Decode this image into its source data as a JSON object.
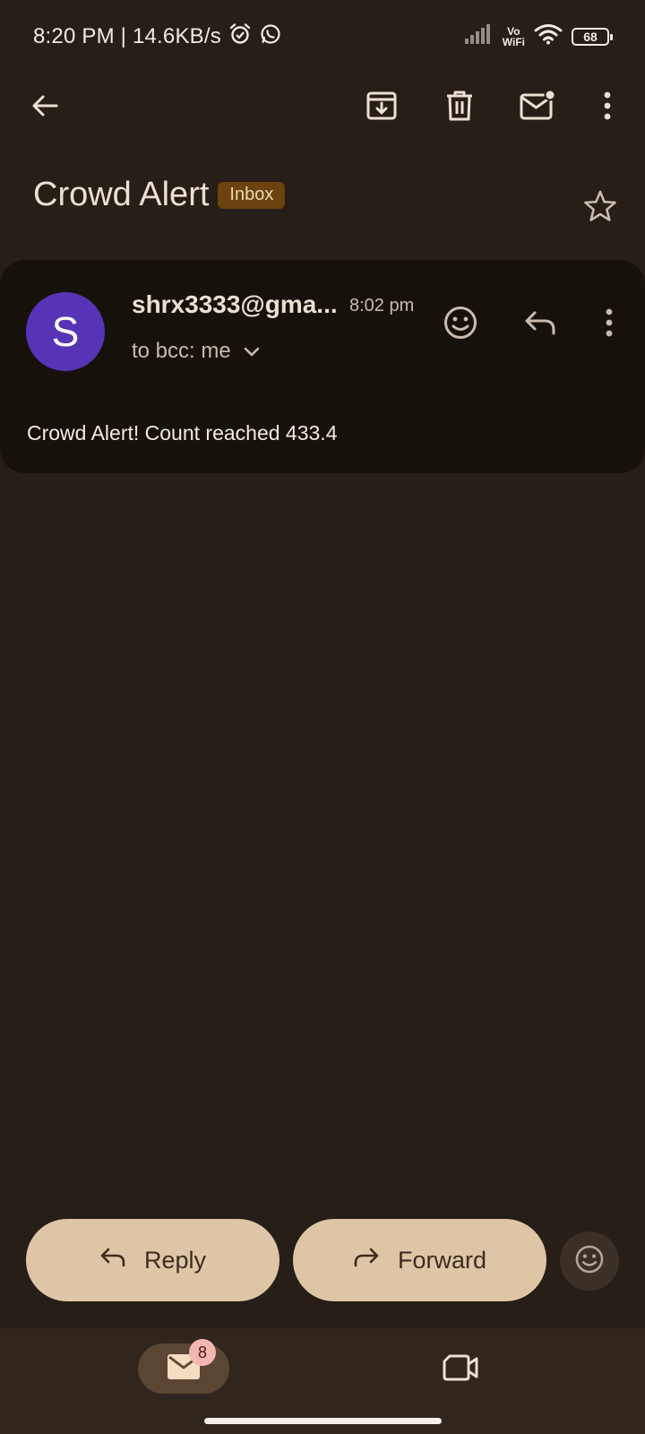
{
  "status_bar": {
    "time_speed": "8:20 PM | 14.6KB/s",
    "vowifi_top": "Vo",
    "vowifi_bottom": "WiFi",
    "battery": "68"
  },
  "toolbar": {
    "back_icon": "arrow-left",
    "archive_icon": "archive-down",
    "delete_icon": "trash",
    "mark_unread_icon": "mail-dot",
    "more_icon": "vertical-dots"
  },
  "email": {
    "subject": "Crowd Alert",
    "label": "Inbox",
    "starred": false
  },
  "message": {
    "avatar_letter": "S",
    "avatar_color": "#5634b5",
    "sender": "shrx3333@gma...",
    "time": "8:02 pm",
    "recipient": "to bcc: me",
    "body": "Crowd Alert! Count reached 433.4"
  },
  "actions": {
    "reply_label": "Reply",
    "forward_label": "Forward"
  },
  "bottom_nav": {
    "mail_badge": "8"
  },
  "colors": {
    "background": "#261e17",
    "card": "#17110c",
    "accent_button": "#dec5a6",
    "label_chip": "#6b4210"
  }
}
